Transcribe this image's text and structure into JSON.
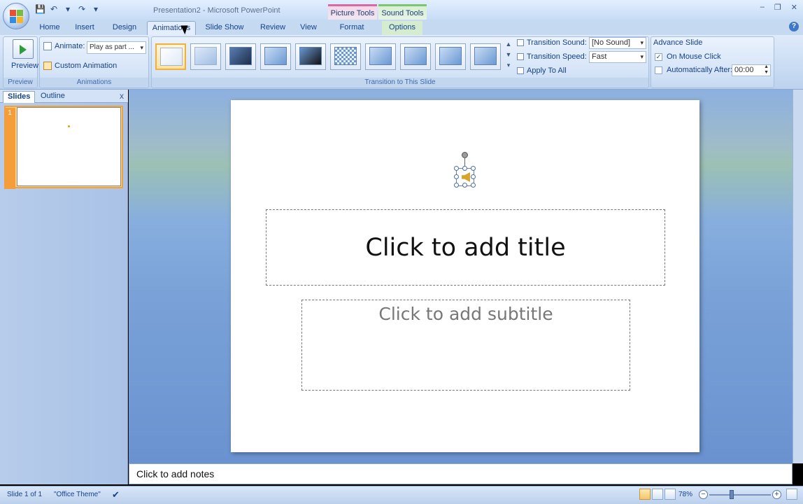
{
  "window": {
    "title": "Presentation2 - Microsoft PowerPoint",
    "context_tabs": [
      "Picture Tools",
      "Sound Tools"
    ],
    "controls": [
      "–",
      "❐",
      "✕"
    ]
  },
  "quick_access": {
    "save_icon": "save-icon",
    "undo_icon": "undo-icon",
    "redo_icon": "redo-icon",
    "customize_icon": "customize-icon"
  },
  "ribbon": {
    "tabs": [
      "Home",
      "Insert",
      "Design",
      "Animations",
      "Slide Show",
      "Review",
      "View",
      "Format",
      "Options"
    ],
    "active_tab": "Animations",
    "groups": {
      "preview": {
        "button_label": "Preview",
        "group_label": "Preview"
      },
      "animations": {
        "animate_label": "Animate:",
        "animate_value": "Play as part ...",
        "custom_animation_label": "Custom Animation",
        "group_label": "Animations"
      },
      "transition": {
        "group_label": "Transition to This Slide",
        "thumbnails": [
          "no-transition",
          "fade-smoothly",
          "fade-through-black",
          "cut",
          "cut-through-black",
          "dissolve",
          "wipe-down",
          "wipe-left",
          "wipe-right",
          "wipe-up"
        ],
        "sound_label": "Transition Sound:",
        "sound_value": "[No Sound]",
        "speed_label": "Transition Speed:",
        "speed_value": "Fast",
        "apply_all_label": "Apply To All"
      },
      "advance": {
        "title": "Advance Slide",
        "on_mouse_click_label": "On Mouse Click",
        "on_mouse_click_checked": true,
        "auto_after_label": "Automatically After:",
        "auto_after_checked": false,
        "auto_after_value": "00:00"
      }
    }
  },
  "left_pane": {
    "tabs": [
      "Slides",
      "Outline"
    ],
    "active_tab": "Slides",
    "close_label": "x",
    "slide_number": "1"
  },
  "slide": {
    "title_placeholder": "Click to add title",
    "subtitle_placeholder": "Click to add subtitle"
  },
  "notes": {
    "placeholder": "Click to add notes"
  },
  "status_bar": {
    "slide_info": "Slide 1 of 1",
    "theme": "\"Office Theme\"",
    "zoom": "78%",
    "zoom_out": "−",
    "zoom_in": "+"
  }
}
